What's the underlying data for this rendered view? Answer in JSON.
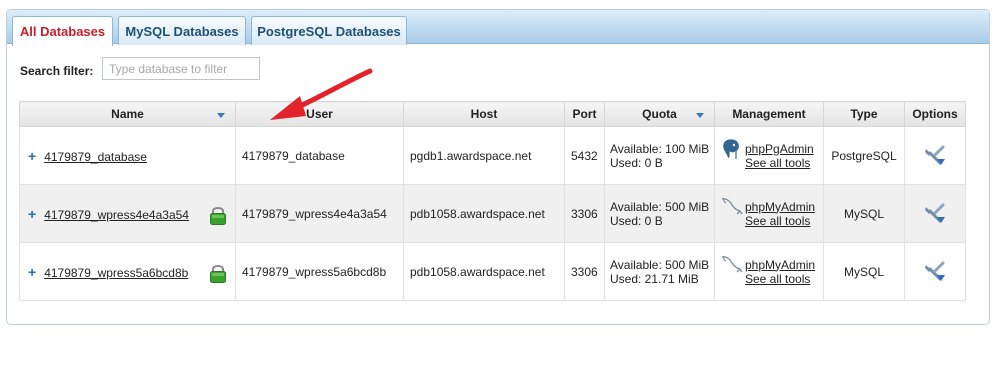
{
  "tabs": [
    {
      "label": "All Databases",
      "active": true
    },
    {
      "label": "MySQL Databases",
      "active": false
    },
    {
      "label": "PostgreSQL Databases",
      "active": false
    }
  ],
  "filter": {
    "label": "Search filter:",
    "placeholder": "Type database to filter"
  },
  "table": {
    "headers": {
      "name": "Name",
      "user": "User",
      "host": "Host",
      "port": "Port",
      "quota": "Quota",
      "management": "Management",
      "type": "Type",
      "options": "Options"
    },
    "rows": [
      {
        "name": "4179879_database",
        "locked": false,
        "user": "4179879_database",
        "host": "pgdb1.awardspace.net",
        "port": "5432",
        "quota_available": "Available: 100 MiB",
        "quota_used": "Used: 0 B",
        "mgmt_logo": "postgresql-elephant-icon",
        "mgmt_tool": "phpPgAdmin",
        "mgmt_all": "See all tools",
        "type": "PostgreSQL"
      },
      {
        "name": "4179879_wpress4e4a3a54",
        "locked": true,
        "user": "4179879_wpress4e4a3a54",
        "host": "pdb1058.awardspace.net",
        "port": "3306",
        "quota_available": "Available: 500 MiB",
        "quota_used": "Used: 0 B",
        "mgmt_logo": "mysql-dolphin-icon",
        "mgmt_tool": "phpMyAdmin",
        "mgmt_all": "See all tools",
        "type": "MySQL"
      },
      {
        "name": "4179879_wpress5a6bcd8b",
        "locked": true,
        "user": "4179879_wpress5a6bcd8b",
        "host": "pdb1058.awardspace.net",
        "port": "3306",
        "quota_available": "Available: 500 MiB",
        "quota_used": "Used: 21.71 MiB",
        "mgmt_logo": "mysql-dolphin-icon",
        "mgmt_tool": "phpMyAdmin",
        "mgmt_all": "See all tools",
        "type": "MySQL"
      }
    ]
  },
  "colors": {
    "active_tab_text": "#c8202a",
    "tab_text": "#1f4f7a",
    "annotation_arrow": "#e3232a",
    "lock_green": "#3aa12f"
  }
}
